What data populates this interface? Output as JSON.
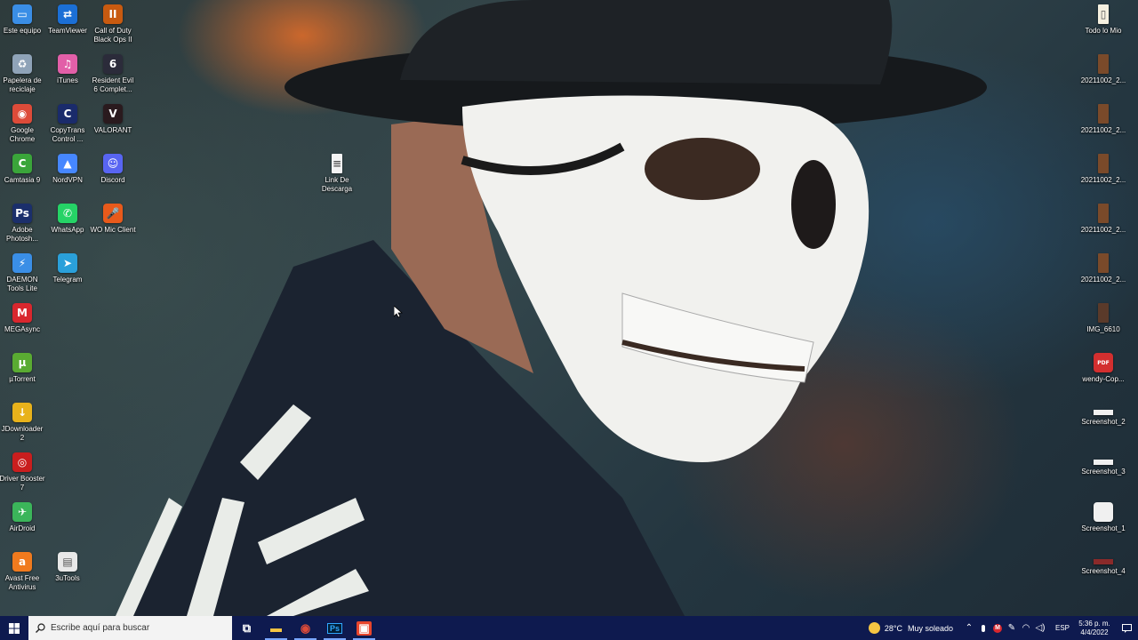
{
  "desktop": {
    "left_icons": [
      {
        "label": "Este equipo",
        "icon": "computer-icon",
        "color": "#3a8ee6",
        "glyph": "▭"
      },
      {
        "label": "TeamViewer",
        "icon": "teamviewer-icon",
        "color": "#1b6fd6",
        "glyph": "⇄"
      },
      {
        "label": "Call of Duty Black Ops II",
        "icon": "call-of-duty-icon",
        "color": "#c85a10",
        "glyph": "II"
      },
      {
        "label": "Papelera de reciclaje",
        "icon": "recycle-bin-icon",
        "color": "#8fa3b8",
        "glyph": "♻"
      },
      {
        "label": "iTunes",
        "icon": "itunes-icon",
        "color": "#e25fa8",
        "glyph": "♫"
      },
      {
        "label": "Resident Evil 6 Complet...",
        "icon": "resident-evil-icon",
        "color": "#2b2b3a",
        "glyph": "6"
      },
      {
        "label": "Google Chrome",
        "icon": "chrome-icon",
        "color": "#dd4b39",
        "glyph": "◉"
      },
      {
        "label": "CopyTrans Control ...",
        "icon": "copytrans-icon",
        "color": "#1a2b6b",
        "glyph": "C"
      },
      {
        "label": "VALORANT",
        "icon": "valorant-icon",
        "color": "#2a1a1e",
        "glyph": "V"
      },
      {
        "label": "Camtasia 9",
        "icon": "camtasia-icon",
        "color": "#3aa53a",
        "glyph": "C"
      },
      {
        "label": "NordVPN",
        "icon": "nordvpn-icon",
        "color": "#4687ff",
        "glyph": "▲"
      },
      {
        "label": "Discord",
        "icon": "discord-icon",
        "color": "#5865f2",
        "glyph": "☺"
      },
      {
        "label": "Adobe Photosh...",
        "icon": "photoshop-icon",
        "color": "#1b2f6b",
        "glyph": "Ps"
      },
      {
        "label": "WhatsApp",
        "icon": "whatsapp-icon",
        "color": "#25d366",
        "glyph": "✆"
      },
      {
        "label": "WO Mic Client",
        "icon": "wo-mic-icon",
        "color": "#e85a1b",
        "glyph": "🎤"
      },
      {
        "label": "DAEMON Tools Lite",
        "icon": "daemon-tools-icon",
        "color": "#3a8ee6",
        "glyph": "⚡"
      },
      {
        "label": "Telegram",
        "icon": "telegram-icon",
        "color": "#2aa0da",
        "glyph": "➤"
      },
      {
        "label": "MEGAsync",
        "icon": "megasync-icon",
        "color": "#d9272e",
        "glyph": "M"
      },
      {
        "label": "µTorrent",
        "icon": "utorrent-icon",
        "color": "#5aab32",
        "glyph": "µ"
      },
      {
        "label": "JDownloader 2",
        "icon": "jdownloader-icon",
        "color": "#e8b21b",
        "glyph": "↓"
      },
      {
        "label": "Driver Booster 7",
        "icon": "driver-booster-icon",
        "color": "#c91e1e",
        "glyph": "◎"
      },
      {
        "label": "AirDroid",
        "icon": "airdroid-icon",
        "color": "#3bb55a",
        "glyph": "✈"
      },
      {
        "label": "Avast Free Antivirus",
        "icon": "avast-icon",
        "color": "#f07a1e",
        "glyph": "a"
      },
      {
        "label": "3uTools",
        "icon": "file-icon",
        "color": "#e8e8e8",
        "glyph": "▤"
      }
    ],
    "middle_icon": {
      "label": "Link De Descarga",
      "icon": "text-file-icon",
      "color": "#f4f4f4",
      "glyph": "≡"
    },
    "right_icons": [
      {
        "label": "Todo lo Mio",
        "icon": "folder-file-icon",
        "color": "#f5f0e0",
        "glyph": "▯"
      },
      {
        "label": "20211002_2...",
        "icon": "image-thumbnail-icon",
        "color": "#7a4a2a",
        "glyph": ""
      },
      {
        "label": "20211002_2...",
        "icon": "image-thumbnail-icon",
        "color": "#7a4a2a",
        "glyph": ""
      },
      {
        "label": "20211002_2...",
        "icon": "image-thumbnail-icon",
        "color": "#7a4a2a",
        "glyph": ""
      },
      {
        "label": "20211002_2...",
        "icon": "image-thumbnail-icon",
        "color": "#7a4a2a",
        "glyph": ""
      },
      {
        "label": "20211002_2...",
        "icon": "image-thumbnail-icon",
        "color": "#7a4a2a",
        "glyph": ""
      },
      {
        "label": "IMG_6610",
        "icon": "image-thumbnail-icon",
        "color": "#5a3a2a",
        "glyph": ""
      },
      {
        "label": "wendy-Cop...",
        "icon": "pdf-icon",
        "color": "#d32f2f",
        "glyph": "PDF"
      },
      {
        "label": "Screenshot_2",
        "icon": "screenshot-thumbnail-icon",
        "color": "#f0f0f0",
        "glyph": ""
      },
      {
        "label": "Screenshot_3",
        "icon": "screenshot-thumbnail-icon",
        "color": "#f0f0f0",
        "glyph": ""
      },
      {
        "label": "Screenshot_1",
        "icon": "screenshot-thumbnail-icon",
        "color": "#f0f0f0",
        "glyph": ""
      },
      {
        "label": "Screenshot_4",
        "icon": "screenshot-thumbnail-icon",
        "color": "#8a2a2a",
        "glyph": ""
      }
    ]
  },
  "taskbar": {
    "search_placeholder": "Escribe aquí para buscar",
    "apps": [
      {
        "name": "task-view-button",
        "icon": "task-view-icon",
        "glyph": "⧉",
        "color": "#ffffff",
        "active": false
      },
      {
        "name": "taskbar-file-explorer",
        "icon": "folder-icon",
        "glyph": "▬",
        "color": "#f5c542",
        "active": true
      },
      {
        "name": "taskbar-chrome",
        "icon": "chrome-icon",
        "glyph": "◉",
        "color": "#dd4b39",
        "active": true
      },
      {
        "name": "taskbar-photoshop",
        "icon": "photoshop-icon",
        "glyph": "Ps",
        "color": "#31a8ff",
        "active": true
      },
      {
        "name": "taskbar-camtasia",
        "icon": "camtasia-recorder-icon",
        "glyph": "▣",
        "color": "#e8452c",
        "active": true
      }
    ],
    "weather": {
      "temp": "28°C",
      "desc": "Muy soleado"
    },
    "language": "ESP",
    "time": "5:36 p. m.",
    "date": "4/4/2022"
  },
  "colors": {
    "taskbar": "#0e1a4f",
    "accent": "#7aa7ff"
  }
}
